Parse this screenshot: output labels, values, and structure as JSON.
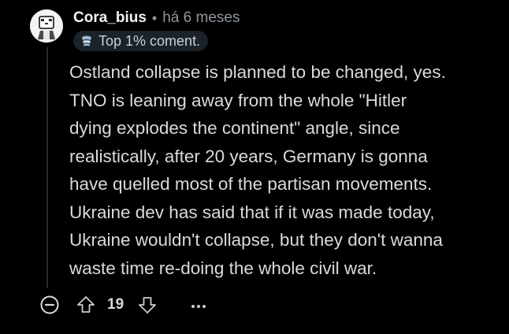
{
  "comment": {
    "author": "Cora_bius",
    "separator": "•",
    "timestamp": "há 6 meses",
    "badge": {
      "icon": "trophy-icon",
      "label": "Top 1% coment."
    },
    "lines": [
      "Ostland collapse is planned to be changed, yes.",
      "TNO is leaning away from the whole \"Hitler",
      "dying explodes the continent\" angle, since",
      "realistically, after 20 years, Germany is gonna",
      "have quelled most of the partisan movements.",
      "Ukraine dev has said that if it was made today,",
      "Ukraine wouldn't collapse, but they don't wanna",
      "waste time re-doing the whole civil war."
    ]
  },
  "actions": {
    "collapse_icon": "minus-circle-icon",
    "upvote_icon": "arrow-up-icon",
    "vote_count": "19",
    "downvote_icon": "arrow-down-icon",
    "more_icon": "more-horizontal-icon"
  },
  "colors": {
    "background": "#000000",
    "text": "#d8dadc",
    "muted": "#8f969c",
    "badge_bg": "#1b2228"
  }
}
